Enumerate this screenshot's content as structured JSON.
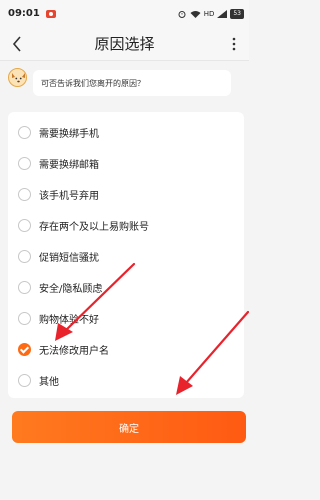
{
  "status_bar": {
    "time": "09:01",
    "network_text": "HD",
    "battery": "53"
  },
  "nav": {
    "title": "原因选择",
    "back_icon": "chevron-left-icon",
    "more_icon": "more-vertical-icon"
  },
  "question": {
    "text": "可否告诉我们您离开的原因？"
  },
  "options": [
    {
      "label": "需要换绑手机",
      "checked": false
    },
    {
      "label": "需要换绑邮箱",
      "checked": false
    },
    {
      "label": "该手机号弃用",
      "checked": false
    },
    {
      "label": "存在两个及以上易购账号",
      "checked": false
    },
    {
      "label": "促销短信骚扰",
      "checked": false
    },
    {
      "label": "安全/隐私顾虑",
      "checked": false
    },
    {
      "label": "购物体验不好",
      "checked": false
    },
    {
      "label": "无法修改用户名",
      "checked": true
    },
    {
      "label": "其他",
      "checked": false
    }
  ],
  "confirm": {
    "label": "确定"
  },
  "colors": {
    "accent": "#ff6a12",
    "annotation_arrow": "#e8232c"
  }
}
